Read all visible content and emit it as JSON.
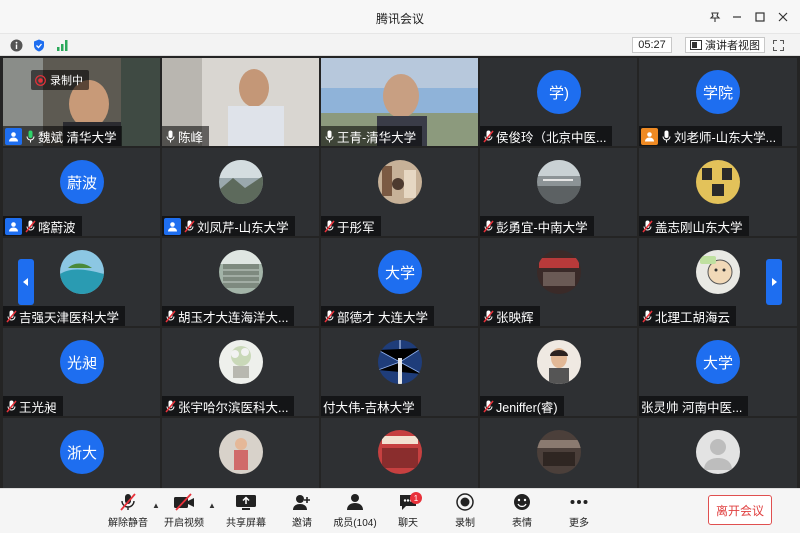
{
  "window": {
    "title": "腾讯会议",
    "timer": "05:27",
    "speaker_view": "演讲者视图"
  },
  "recording": {
    "label": "录制中"
  },
  "tiles": [
    {
      "name": "魏斌 清华大学"
    },
    {
      "name": "陈峰"
    },
    {
      "name": "王青-清华大学"
    },
    {
      "name": "侯俊玲（北京中医...",
      "avatar_text": "学)"
    },
    {
      "name": "刘老师-山东大学...",
      "avatar_text": "学院"
    },
    {
      "name": "喀蔚波",
      "avatar_text": "蔚波"
    },
    {
      "name": "刘凤芹-山东大学"
    },
    {
      "name": "于彤军"
    },
    {
      "name": "彭勇宜-中南大学"
    },
    {
      "name": "盖志刚山东大学"
    },
    {
      "name": "吉强天津医科大学"
    },
    {
      "name": "胡玉才大连海洋大..."
    },
    {
      "name": "部德才 大连大学",
      "avatar_text": "大学"
    },
    {
      "name": "张映辉"
    },
    {
      "name": "北理工胡海云"
    },
    {
      "name": "王光昶",
      "avatar_text": "光昶"
    },
    {
      "name": "张宇哈尔滨医科大..."
    },
    {
      "name": "付大伟-吉林大学"
    },
    {
      "name": "Jeniffer(睿)"
    },
    {
      "name": "张灵帅 河南中医...",
      "avatar_text": "大学"
    },
    {
      "name": "",
      "avatar_text": "浙大"
    },
    {
      "name": ""
    },
    {
      "name": ""
    },
    {
      "name": ""
    },
    {
      "name": ""
    }
  ],
  "toolbar": {
    "mute": "解除静音",
    "video": "开启视频",
    "share": "共享屏幕",
    "invite": "邀请",
    "members": "成员(104)",
    "chat": "聊天",
    "chat_badge": "1",
    "record": "录制",
    "emoji": "表情",
    "more": "更多",
    "leave": "离开会议"
  },
  "colors": {
    "accent": "#1e6ef0",
    "active_border": "#2aa85a",
    "danger": "#e04040",
    "host_orange": "#ef8a23"
  }
}
